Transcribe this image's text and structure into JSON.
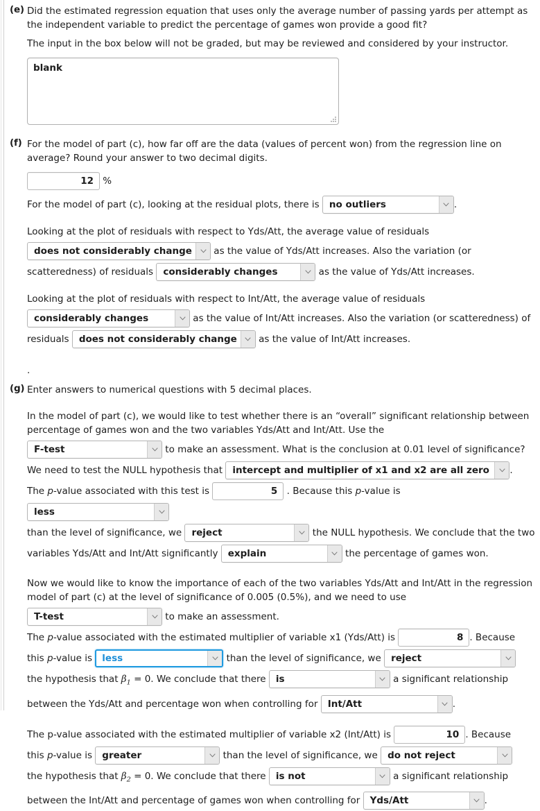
{
  "parts": {
    "e": {
      "label": "(e)",
      "question": "Did the estimated regression equation that uses only the average number of passing yards per attempt as the independent variable to predict the percentage of games won provide a good fit?",
      "note": "The input in the box below will not be graded, but may be reviewed and considered by your instructor.",
      "textarea_value": "blank"
    },
    "f": {
      "label": "(f)",
      "question": "For the model of part (c), how far off are the data (values of percent won) from the regression line on average? Round your answer to two decimal digits.",
      "rmse_value": "12",
      "percent_symbol": "%",
      "outliers_prefix": "For the model of part (c), looking at the residual plots, there is",
      "outliers_value": "no outliers",
      "outliers_suffix": ".",
      "yds_intro": "Looking at the plot of residuals with respect to Yds/Att, the average value of residuals",
      "yds_mean_value": "does not considerably change",
      "yds_mid_text": "as the value of Yds/Att increases. Also the variation (or scatteredness) of residuals",
      "yds_var_value": "considerably changes",
      "yds_end_text": "as the value of Yds/Att increases.",
      "int_intro": "Looking at the plot of residuals with respect to Int/Att, the average value of residuals",
      "int_mean_value": "considerably changes",
      "int_mid_text": "as the value of Int/Att increases. Also the variation (or scatteredness) of residuals",
      "int_var_value": "does not considerably change",
      "int_end_text": "as the value of Int/Att increases.",
      "stray_period": "."
    },
    "g": {
      "label": "(g)",
      "question": "Enter answers to numerical questions with 5 decimal places.",
      "ftest": {
        "intro": "In the model of part (c), we would like to test whether there is an “overall” significant relationship between percentage of games won and the two variables Yds/Att and Int/Att. Use the",
        "test_value": "F-test",
        "after_test": "to make an assessment. What is the conclusion at 0.01 level of significance?",
        "null_prefix": "We need to test the NULL hypothesis that",
        "null_value": "intercept and multiplier of x1 and x2 are all zero",
        "null_suffix": ".",
        "pvalue_prefix": "The",
        "pvalue_italic": "p",
        "pvalue_prefix2": "-value associated with this test is",
        "pvalue_value": "5",
        "pvalue_mid": ". Because this",
        "pvalue_mid2": "-value is",
        "compare_value": "less",
        "compare_after": "than the level of significance, we",
        "decision_value": "reject",
        "decision_after": "the NULL hypothesis. We conclude that the two variables Yds/Att and Int/Att significantly",
        "explain_value": "explain",
        "explain_after": "the percentage of games won."
      },
      "ttest": {
        "intro": "Now we would like to know the importance of each of the two variables Yds/Att and Int/Att in the regression model of part (c) at the level of significance of 0.005 (0.5%), and we need to use",
        "test_value": "T-test",
        "after_test": "to make an assessment.",
        "x1": {
          "pvalue_prefix": "-value associated with the estimated multiplier of variable x1 (Yds/Att) is",
          "pvalue_value": "8",
          "because": ". Because",
          "this_prefix": "this",
          "this_suffix": "-value is",
          "compare_value": "less",
          "compare_after": "than the level of significance, we",
          "decision_value": "reject",
          "hypothesis_prefix": "the hypothesis that",
          "beta": "β",
          "beta_sub": "1",
          "hypothesis_mid": "= 0. We conclude that there",
          "is_value": "is",
          "is_after": "a significant relationship",
          "control_prefix": "between the Yds/Att and percentage won when controlling for",
          "control_value": "Int/Att",
          "control_suffix": "."
        },
        "x2": {
          "pvalue_prefix": "The p-value associated with the estimated multiplier of variable x2 (Int/Att) is",
          "pvalue_value": "10",
          "because": ". Because",
          "this_prefix": "this",
          "this_suffix": "-value is",
          "compare_value": "greater",
          "compare_after": "than the level of significance, we",
          "decision_value": "do not reject",
          "hypothesis_prefix": "the hypothesis that",
          "beta": "β",
          "beta_sub": "2",
          "hypothesis_mid": "= 0. We conclude that there",
          "is_value": "is not",
          "is_after": "a significant relationship",
          "control_prefix": "between the Int/Att and percentage of games won when controlling for",
          "control_value": "Yds/Att",
          "control_suffix": "."
        }
      }
    }
  },
  "icons": {
    "chevron_down": "chevron-down-icon",
    "resize_grip": "resize-grip-icon"
  },
  "colors": {
    "focus_blue": "#1f9ae0",
    "text": "#1d1d1d",
    "border": "#b4b4b4",
    "arrow_bg": "#e8e8e8"
  }
}
